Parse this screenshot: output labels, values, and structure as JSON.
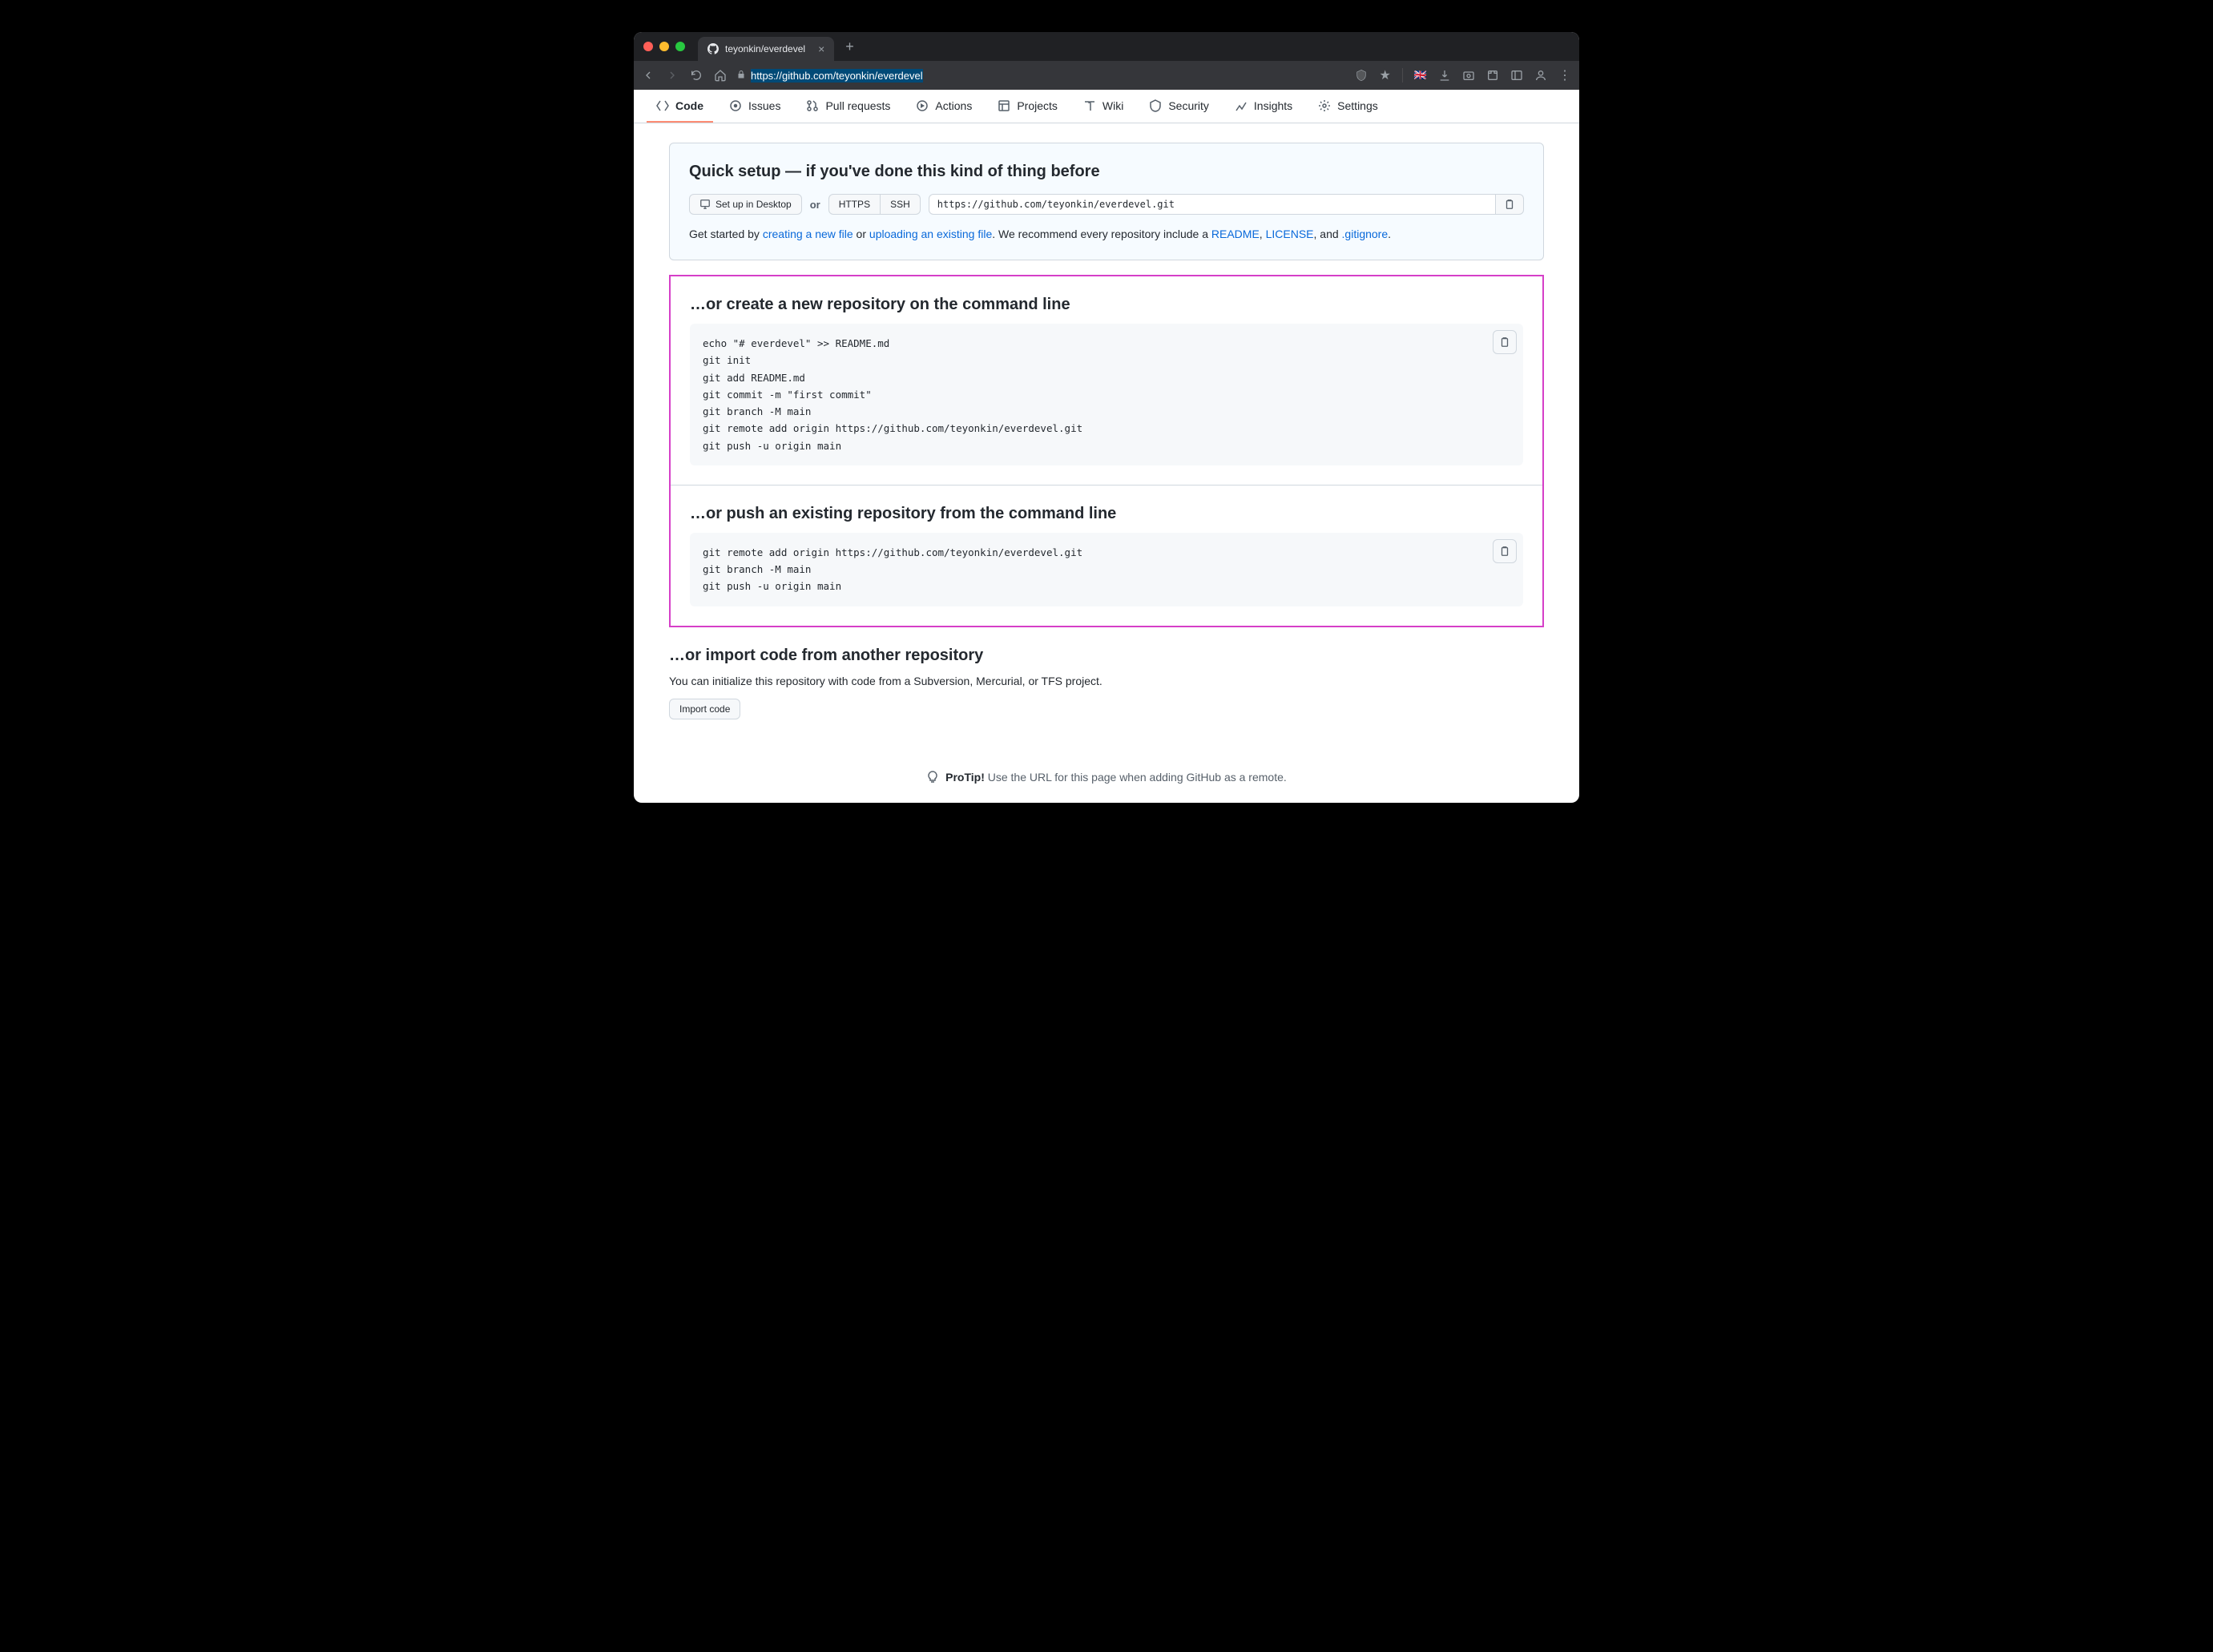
{
  "browser": {
    "tab_title": "teyonkin/everdevel",
    "url": "https://github.com/teyonkin/everdevel"
  },
  "repo_nav": [
    {
      "id": "code",
      "label": "Code"
    },
    {
      "id": "issues",
      "label": "Issues"
    },
    {
      "id": "pulls",
      "label": "Pull requests"
    },
    {
      "id": "actions",
      "label": "Actions"
    },
    {
      "id": "projects",
      "label": "Projects"
    },
    {
      "id": "wiki",
      "label": "Wiki"
    },
    {
      "id": "security",
      "label": "Security"
    },
    {
      "id": "insights",
      "label": "Insights"
    },
    {
      "id": "settings",
      "label": "Settings"
    }
  ],
  "quick_setup": {
    "title": "Quick setup — if you've done this kind of thing before",
    "desktop_btn": "Set up in Desktop",
    "or": "or",
    "https_btn": "HTTPS",
    "ssh_btn": "SSH",
    "clone_url": "https://github.com/teyonkin/everdevel.git",
    "help_pre": "Get started by ",
    "link_new_file": "creating a new file",
    "help_or": " or ",
    "link_upload": "uploading an existing file",
    "help_mid": ". We recommend every repository include a ",
    "link_readme": "README",
    "help_comma": ", ",
    "link_license": "LICENSE",
    "help_and": ", and ",
    "link_gitignore": ".gitignore",
    "help_end": "."
  },
  "section_create": {
    "title": "…or create a new repository on the command line",
    "code": "echo \"# everdevel\" >> README.md\ngit init\ngit add README.md\ngit commit -m \"first commit\"\ngit branch -M main\ngit remote add origin https://github.com/teyonkin/everdevel.git\ngit push -u origin main"
  },
  "section_push": {
    "title": "…or push an existing repository from the command line",
    "code": "git remote add origin https://github.com/teyonkin/everdevel.git\ngit branch -M main\ngit push -u origin main"
  },
  "section_import": {
    "title": "…or import code from another repository",
    "desc": "You can initialize this repository with code from a Subversion, Mercurial, or TFS project.",
    "button": "Import code"
  },
  "protip": {
    "label": "ProTip!",
    "text": " Use the URL for this page when adding GitHub as a remote."
  }
}
